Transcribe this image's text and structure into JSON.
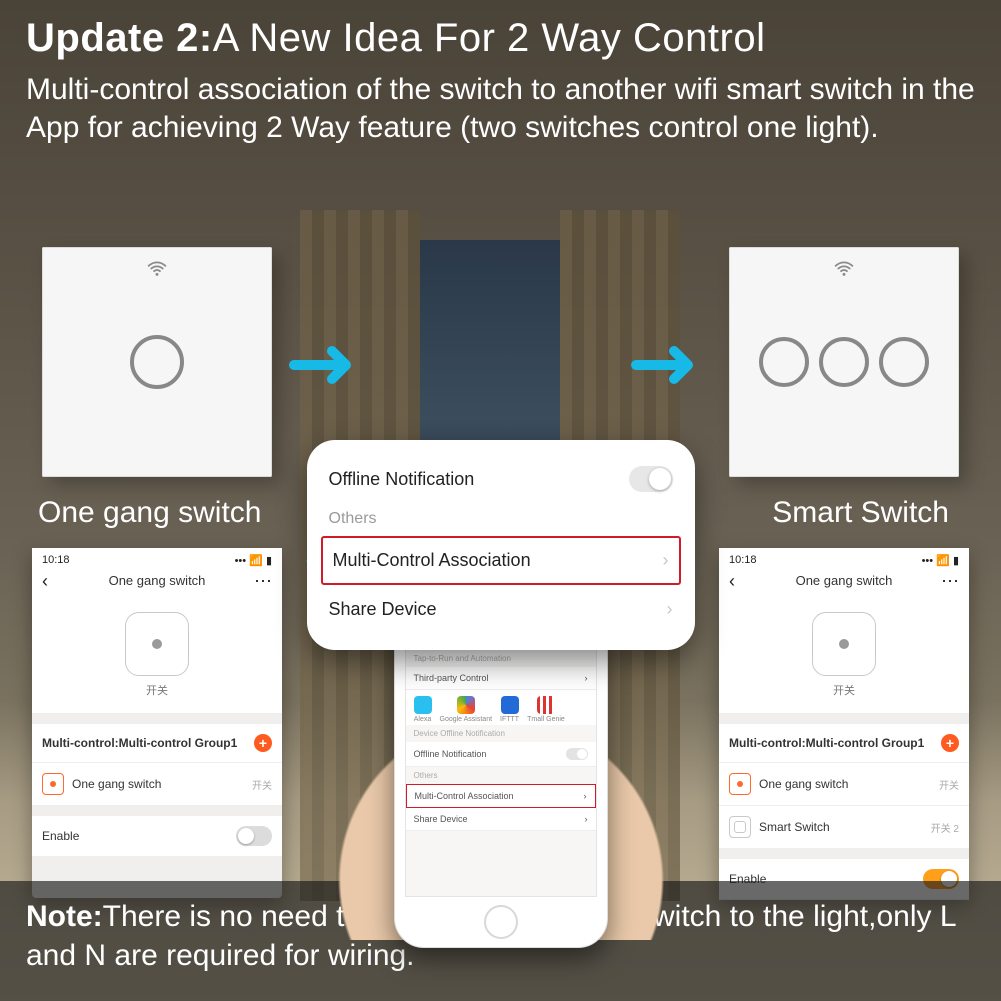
{
  "header": {
    "title_bold": "Update 2:",
    "title_rest": "A New Idea For 2 Way Control",
    "subtitle": "Multi-control association of the switch to another wifi smart switch in the App for achieving 2 Way feature (two switches control one light)."
  },
  "note": {
    "label": "Note:",
    "text": "There is no need to wire the new added switch to the light,only L and N are required for wiring."
  },
  "plate_left_label": "One gang switch",
  "plate_right_label": "Smart Switch",
  "popup": {
    "row1": "Offline Notification",
    "section": "Others",
    "row_hl": "Multi-Control Association",
    "row3": "Share Device"
  },
  "mock": {
    "time": "10:18",
    "signal": "📶",
    "title": "One gang switch",
    "hero_caption": "开关",
    "group_header": "Multi-control:Multi-control Group1",
    "dev1_name": "One gang switch",
    "dev1_sub": "开关",
    "dev2_name": "Smart Switch",
    "dev2_sub": "开关 2",
    "enable": "Enable"
  },
  "phone": {
    "section1": "Tap-to-Run and Automation",
    "row1": "Third-party Control",
    "app1": "Alexa",
    "app2": "Google Assistant",
    "app3": "IFTTT",
    "app4": "Tmall Genie",
    "section2": "Device Offline Notification",
    "row2": "Offline Notification",
    "section3": "Others",
    "row_hl": "Multi-Control Association",
    "row3": "Share Device"
  }
}
